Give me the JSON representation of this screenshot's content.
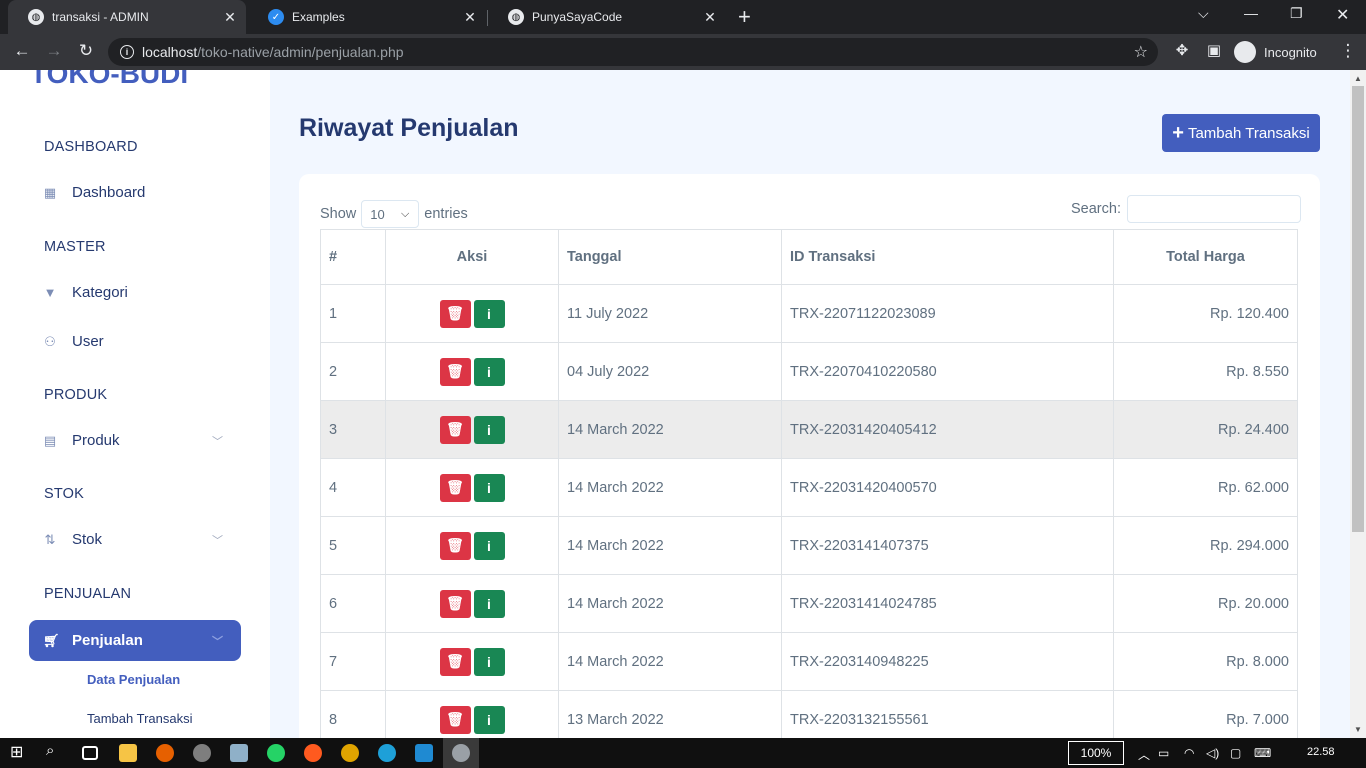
{
  "browser": {
    "tabs": [
      {
        "title": "transaksi - ADMIN",
        "active": true
      },
      {
        "title": "Examples",
        "active": false
      },
      {
        "title": "PunyaSayaCode",
        "active": false
      }
    ],
    "url_host": "localhost",
    "url_path": "/toko-native/admin/penjualan.php",
    "profile_label": "Incognito"
  },
  "sidebar": {
    "logo": "TOKO-BUDI",
    "sections": [
      {
        "title": "DASHBOARD"
      },
      {
        "title": "MASTER"
      },
      {
        "title": "PRODUK"
      },
      {
        "title": "STOK"
      },
      {
        "title": "PENJUALAN"
      }
    ],
    "items": [
      {
        "label": "Dashboard",
        "icon": "grid-icon"
      },
      {
        "label": "Kategori",
        "icon": "filter-icon"
      },
      {
        "label": "User",
        "icon": "people-icon"
      },
      {
        "label": "Produk",
        "icon": "archive-icon"
      },
      {
        "label": "Stok",
        "icon": "sort-arrows-icon"
      },
      {
        "label": "Penjualan",
        "icon": "cart-icon"
      }
    ],
    "subitems": [
      {
        "label": "Data Penjualan"
      },
      {
        "label": "Tambah Transaksi"
      }
    ]
  },
  "main": {
    "title": "Riwayat Penjualan",
    "add_button": "Tambah Transaksi",
    "show_label": "Show",
    "entries_value": "10",
    "entries_label": "entries",
    "search_label": "Search:",
    "columns": [
      "#",
      "Aksi",
      "Tanggal",
      "ID Transaksi",
      "Total Harga"
    ],
    "rows": [
      {
        "no": "1",
        "date": "11 July 2022",
        "id": "TRX-22071122023089",
        "total": "Rp. 120.400"
      },
      {
        "no": "2",
        "date": "04 July 2022",
        "id": "TRX-22070410220580",
        "total": "Rp. 8.550"
      },
      {
        "no": "3",
        "date": "14 March 2022",
        "id": "TRX-22031420405412",
        "total": "Rp. 24.400"
      },
      {
        "no": "4",
        "date": "14 March 2022",
        "id": "TRX-22031420400570",
        "total": "Rp. 62.000"
      },
      {
        "no": "5",
        "date": "14 March 2022",
        "id": "TRX-2203141407375",
        "total": "Rp. 294.000"
      },
      {
        "no": "6",
        "date": "14 March 2022",
        "id": "TRX-22031414024785",
        "total": "Rp. 20.000"
      },
      {
        "no": "7",
        "date": "14 March 2022",
        "id": "TRX-2203140948225",
        "total": "Rp. 8.000"
      },
      {
        "no": "8",
        "date": "13 March 2022",
        "id": "TRX-2203132155561",
        "total": "Rp. 7.000"
      }
    ]
  },
  "taskbar": {
    "zoom": "100%",
    "time": "22.58"
  },
  "colors": {
    "primary": "#435ebe",
    "danger": "#dc3545",
    "success": "#198754",
    "text_dark": "#25396f"
  }
}
